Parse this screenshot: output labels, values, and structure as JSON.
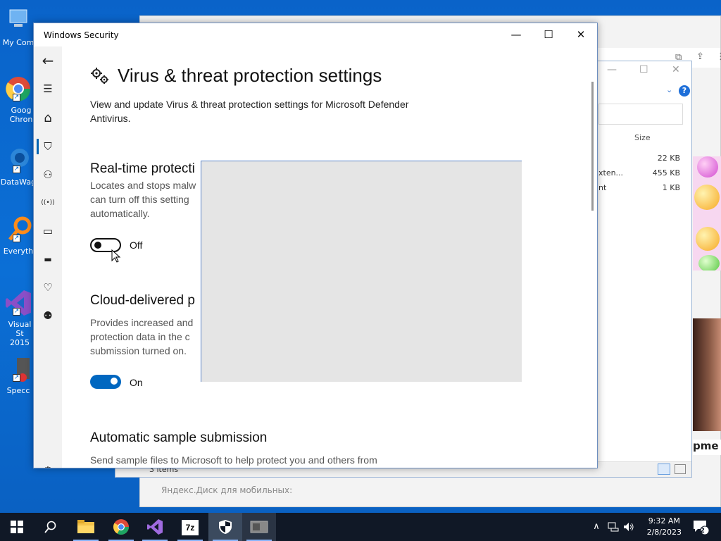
{
  "desktop": {
    "icons": [
      {
        "label": "My Com",
        "name": "desktop-icon-my-computer"
      },
      {
        "label": "Goog Chron",
        "name": "desktop-icon-google-chrome"
      },
      {
        "label": "DataWag",
        "name": "desktop-icon-datawag"
      },
      {
        "label": "Everyth",
        "name": "desktop-icon-everything"
      },
      {
        "label": "Visual St 2015",
        "name": "desktop-icon-visual-studio"
      },
      {
        "label": "Specc",
        "name": "desktop-icon-speccy"
      }
    ]
  },
  "browser": {
    "status_text": "Яндекс.Диск для мобильных:"
  },
  "explorer": {
    "column_size": "Size",
    "rows": [
      {
        "name": "",
        "size": "22 KB"
      },
      {
        "name": "xten...",
        "size": "455 KB"
      },
      {
        "name": "nt",
        "size": "1 KB"
      }
    ],
    "footer": "3 items",
    "help": "?"
  },
  "right_text": "pme",
  "window": {
    "title": "Windows Security",
    "minimize": "—",
    "maximize": "☐",
    "close": "✕",
    "heading": "Virus & threat protection settings",
    "subtitle": "View and update Virus & threat protection settings for Microsoft Defender Antivirus.",
    "sections": [
      {
        "title": "Real-time protecti",
        "desc": "Locates and stops malw can turn off this setting automatically.",
        "toggle_state": "off",
        "toggle_label": "Off"
      },
      {
        "title": "Cloud-delivered p",
        "desc": "Provides increased and protection data in the c submission turned on.",
        "toggle_state": "on",
        "toggle_label": "On"
      },
      {
        "title": "Automatic sample submission",
        "desc": "Send sample files to Microsoft to help protect you and others from"
      }
    ],
    "nav": [
      {
        "name": "back-icon",
        "glyph": "←"
      },
      {
        "name": "hamburger-menu-icon",
        "glyph": "☰"
      },
      {
        "name": "home-icon",
        "glyph": "⌂"
      },
      {
        "name": "shield-icon",
        "glyph": "⛉"
      },
      {
        "name": "account-icon",
        "glyph": "⚇"
      },
      {
        "name": "firewall-network-icon",
        "glyph": "((•))"
      },
      {
        "name": "app-browser-icon",
        "glyph": "▭"
      },
      {
        "name": "device-security-icon",
        "glyph": "▬"
      },
      {
        "name": "device-health-icon",
        "glyph": "♡"
      },
      {
        "name": "family-options-icon",
        "glyph": "⚉"
      },
      {
        "name": "settings-gear-icon",
        "glyph": "⚙"
      }
    ]
  },
  "taskbar": {
    "items": [
      {
        "name": "start-button",
        "glyph": "⊞"
      },
      {
        "name": "search-button",
        "glyph": "⚲"
      },
      {
        "name": "file-explorer-taskbar",
        "glyph": "▆"
      },
      {
        "name": "chrome-taskbar",
        "glyph": "◉"
      },
      {
        "name": "visual-studio-taskbar",
        "glyph": "⋈"
      },
      {
        "name": "7zip-taskbar",
        "glyph": "7z"
      },
      {
        "name": "windows-security-taskbar",
        "glyph": "⛉"
      },
      {
        "name": "app-taskbar",
        "glyph": "▣"
      }
    ],
    "tray_up": "∧",
    "tray_network": "🖧",
    "tray_volume": "🔊",
    "time": "9:32 AM",
    "date": "2/8/2023",
    "notifications": "2"
  },
  "colors": {
    "accent": "#0067c0",
    "desktop": "#0b6fd6",
    "taskbar": "#101826"
  }
}
